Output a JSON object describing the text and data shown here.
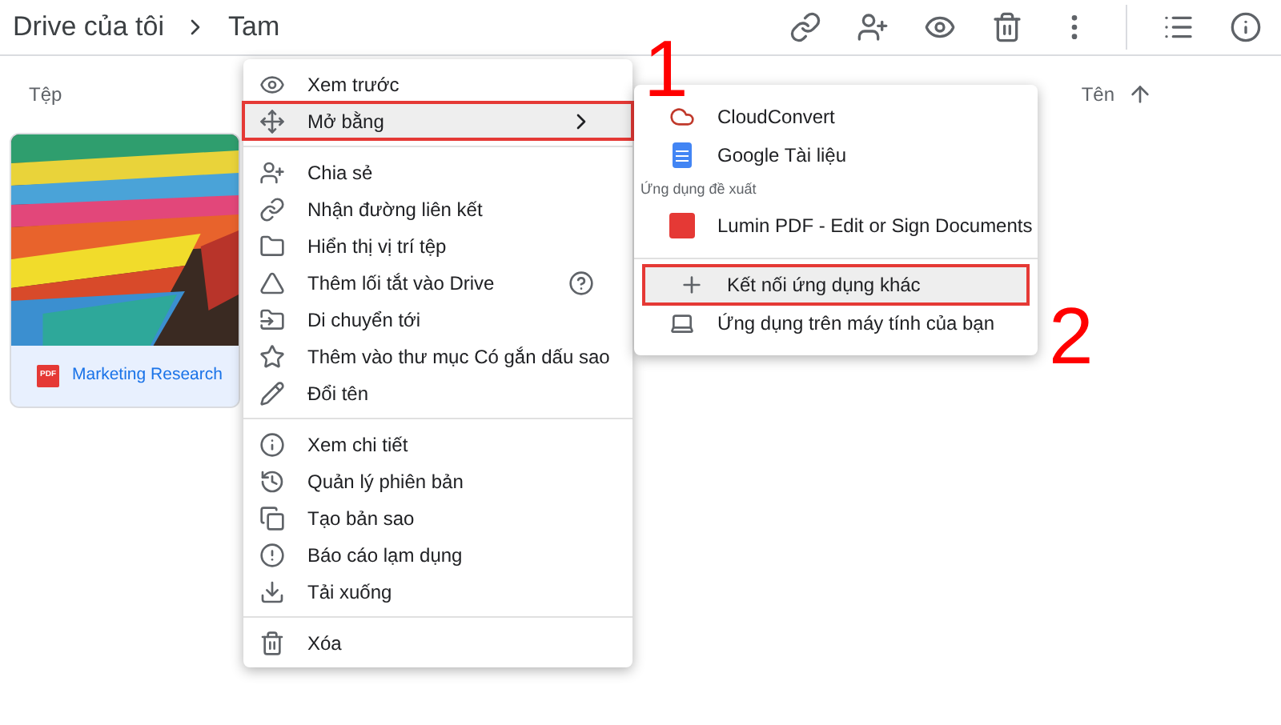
{
  "breadcrumb": [
    "Drive của tôi",
    "Tam"
  ],
  "files_header": {
    "left": "Tệp",
    "sort": "Tên"
  },
  "file_card": {
    "badge": "PDF",
    "name": "Marketing Research"
  },
  "context_menu": {
    "sections": [
      [
        {
          "label": "Xem trước",
          "highlighted": false,
          "submenu": false,
          "help": false
        },
        {
          "label": "Mở bằng",
          "highlighted": true,
          "submenu": true,
          "help": false
        }
      ],
      [
        {
          "label": "Chia sẻ",
          "highlighted": false,
          "submenu": false,
          "help": false
        },
        {
          "label": "Nhận đường liên kết",
          "highlighted": false,
          "submenu": false,
          "help": false
        },
        {
          "label": "Hiển thị vị trí tệp",
          "highlighted": false,
          "submenu": false,
          "help": false
        },
        {
          "label": "Thêm lối tắt vào Drive",
          "highlighted": false,
          "submenu": false,
          "help": true
        },
        {
          "label": "Di chuyển tới",
          "highlighted": false,
          "submenu": false,
          "help": false
        },
        {
          "label": "Thêm vào thư mục Có gắn dấu sao",
          "highlighted": false,
          "submenu": false,
          "help": false
        },
        {
          "label": "Đổi tên",
          "highlighted": false,
          "submenu": false,
          "help": false
        }
      ],
      [
        {
          "label": "Xem chi tiết",
          "highlighted": false,
          "submenu": false,
          "help": false
        },
        {
          "label": "Quản lý phiên bản",
          "highlighted": false,
          "submenu": false,
          "help": false
        },
        {
          "label": "Tạo bản sao",
          "highlighted": false,
          "submenu": false,
          "help": false
        },
        {
          "label": "Báo cáo lạm dụng",
          "highlighted": false,
          "submenu": false,
          "help": false
        },
        {
          "label": "Tải xuống",
          "highlighted": false,
          "submenu": false,
          "help": false
        }
      ],
      [
        {
          "label": "Xóa",
          "highlighted": false,
          "submenu": false,
          "help": false
        }
      ]
    ]
  },
  "open_with_menu": {
    "sections": [
      {
        "items": [
          {
            "label": "CloudConvert",
            "highlighted": false
          },
          {
            "label": "Google Tài liệu",
            "highlighted": false
          }
        ]
      },
      {
        "heading": "Ứng dụng đề xuất",
        "items": [
          {
            "label": "Lumin PDF - Edit or Sign Documents",
            "highlighted": false
          }
        ]
      },
      {
        "items": [
          {
            "label": "Kết nối ứng dụng khác",
            "highlighted": true
          },
          {
            "label": "Ứng dụng trên máy tính của bạn",
            "highlighted": false
          }
        ]
      }
    ]
  },
  "step_numbers": [
    "1",
    "2"
  ]
}
